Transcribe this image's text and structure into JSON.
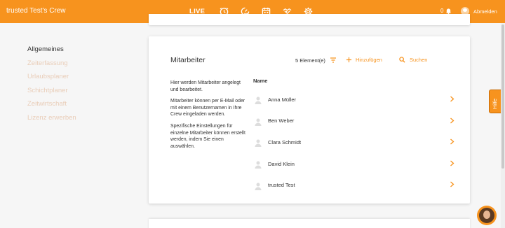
{
  "app": {
    "title": "trusted Test's Crew",
    "accent": "#f7931e"
  },
  "nav": {
    "live_label": "LIVE",
    "icons": [
      "clock-icon",
      "timer-icon",
      "calendar-icon",
      "handshake-icon",
      "gear-icon"
    ],
    "active": "gear-icon"
  },
  "header": {
    "notification_count": "0",
    "logout_label": "Abmelden"
  },
  "sidebar": {
    "items": [
      {
        "label": "Allgemeines",
        "active": true
      },
      {
        "label": "Zeiterfassung",
        "active": false
      },
      {
        "label": "Urlaubsplaner",
        "active": false
      },
      {
        "label": "Schichtplaner",
        "active": false
      },
      {
        "label": "Zeitwirtschaft",
        "active": false
      },
      {
        "label": "Lizenz erwerben",
        "active": false
      }
    ]
  },
  "card": {
    "title": "Mitarbeiter",
    "count_label": "5 Element(e)",
    "add_label": "Hinzufügen",
    "search_label": "Suchen",
    "description": [
      "Hier werden Mitarbeiter angelegt und bearbeitet.",
      "Mitarbeiter können per E-Mail oder mit einem Benutzernamen in Ihre Crew eingeladen werden.",
      "Spezifische Einstellungen für einzelne Mitarbeiter können erstellt werden, indem Sie einen auswählen."
    ],
    "column_header": "Name",
    "employees": [
      "Anna Müller",
      "Ben Weber",
      "Clara Schmidt",
      "David Klein",
      "trusted Test"
    ]
  },
  "help": {
    "label": "Hilfe"
  }
}
